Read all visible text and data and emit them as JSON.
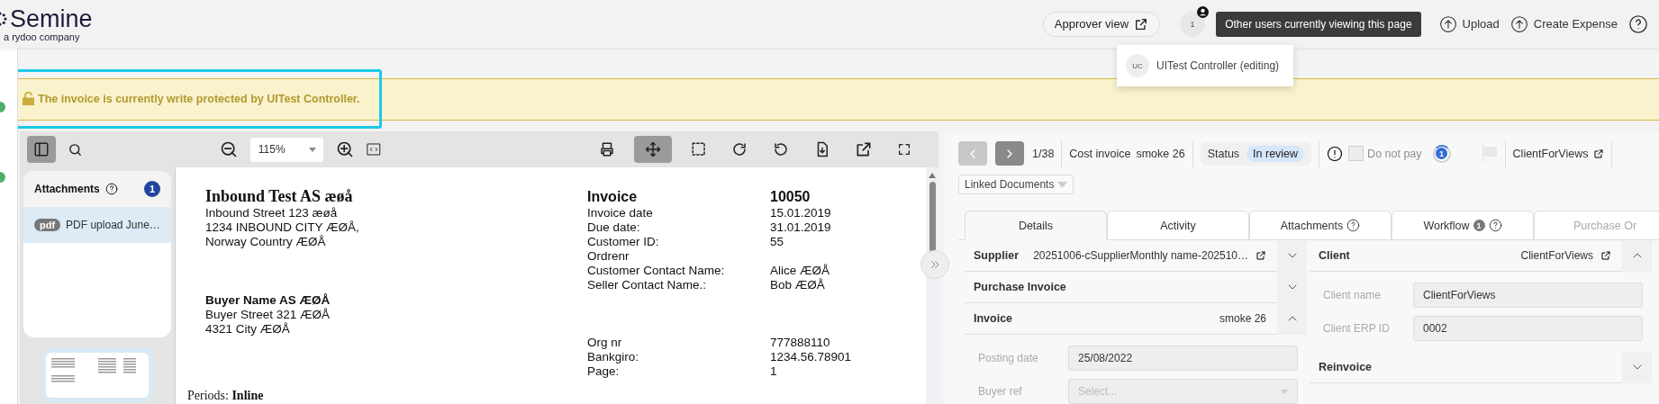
{
  "header": {
    "logo": {
      "name": "Semine",
      "tagline": "a rydoo company"
    },
    "approver_view": "Approver view",
    "viewer_count": "1",
    "tooltip": "Other users currently viewing this page",
    "actions": [
      {
        "label": "Upload"
      },
      {
        "label": "Create Expense"
      }
    ]
  },
  "viewers_popover": [
    {
      "initials": "UC",
      "name": "UITest Controller (editing)"
    }
  ],
  "banner": {
    "text": "The invoice is currently write protected by UITest Controller.",
    "highlighted": true
  },
  "viewer_toolbar": {
    "sidebar_open": true,
    "zoom": "115%",
    "tools": [
      {
        "kind": "print",
        "selected": false
      },
      {
        "kind": "pan",
        "selected": true
      },
      {
        "kind": "select",
        "selected": false
      },
      {
        "kind": "rotate-right",
        "selected": false
      },
      {
        "kind": "rotate-left",
        "selected": false
      },
      {
        "kind": "download",
        "selected": false
      },
      {
        "kind": "open",
        "selected": false
      },
      {
        "kind": "fullscreen",
        "selected": false
      }
    ]
  },
  "attachments": {
    "title": "Attachments",
    "count": "1",
    "items": [
      {
        "type": "pdf",
        "name": "PDF upload June…",
        "selected": true
      }
    ]
  },
  "document": {
    "seller": {
      "name": "Inbound Test AS æøå",
      "lines": [
        "Inbound Street 123 æøå",
        "1234 INBOUND CITY ÆØÅ,",
        "Norway Country ÆØÅ"
      ]
    },
    "buyer": {
      "name": "Buyer Name AS ÆØÅ",
      "lines": [
        "Buyer Street 321 ÆØÅ",
        "4321 City ÆØÅ"
      ]
    },
    "title": "Invoice",
    "number": "10050",
    "details": [
      {
        "label": "Invoice date",
        "value": "15.01.2019"
      },
      {
        "label": "Due date:",
        "value": "31.01.2019"
      },
      {
        "label": "Customer ID:",
        "value": "55"
      },
      {
        "label": "Ordrenr"
      },
      {
        "label": "Customer Contact Name:",
        "value": "Alice ÆØÅ"
      },
      {
        "label": "Seller Contact Name.:",
        "value": "Bob ÆØÅ"
      }
    ],
    "registry": [
      {
        "label": "Org nr",
        "value": "777888110"
      },
      {
        "label": "Bankgiro:",
        "value": "1234.56.78901"
      },
      {
        "label": "Page:",
        "value": "1"
      }
    ],
    "footer": "Periods: **Inline**"
  },
  "record": {
    "prev_disabled": true,
    "position": "1/38",
    "type": "Cost invoice",
    "reference": "smoke 26",
    "status_label": "Status",
    "status": "In review",
    "do_not_pay": {
      "label": "Do not pay",
      "checked": false,
      "disabled": true
    },
    "workflow_step": "1",
    "client_link": "ClientForViews",
    "linked_documents": "Linked Documents"
  },
  "tabs": [
    {
      "label": "Details",
      "selected": true,
      "help": false,
      "disabled": false
    },
    {
      "label": "Activity",
      "selected": false,
      "help": false,
      "disabled": false
    },
    {
      "label": "Attachments",
      "selected": false,
      "help": true,
      "disabled": false
    },
    {
      "label": "Workflow",
      "selected": false,
      "badge": "1",
      "help": true,
      "disabled": false
    },
    {
      "label": "Purchase Or",
      "selected": false,
      "help": false,
      "disabled": true
    }
  ],
  "left_sections": [
    {
      "title": "Supplier",
      "value": "20251006-cSupplierMonthly name-202510…",
      "link": true,
      "expanded": false
    },
    {
      "title": "Purchase Invoice",
      "link": false,
      "expanded": false
    },
    {
      "title": "Invoice",
      "value": "smoke 26",
      "link": false,
      "expanded": true,
      "fields": [
        {
          "label": "Posting date",
          "value": "25/08/2022",
          "kind": "text"
        },
        {
          "label": "Buyer ref",
          "placeholder": "Select...",
          "kind": "select"
        }
      ]
    }
  ],
  "right_sections": [
    {
      "title": "Client",
      "value": "ClientForViews",
      "link": true,
      "expanded": true,
      "fields": [
        {
          "label": "Client name",
          "value": "ClientForViews",
          "kind": "text"
        },
        {
          "label": "Client ERP ID",
          "value": "0002",
          "kind": "text"
        }
      ]
    },
    {
      "title": "Reinvoice",
      "link": false,
      "expanded": false
    }
  ]
}
